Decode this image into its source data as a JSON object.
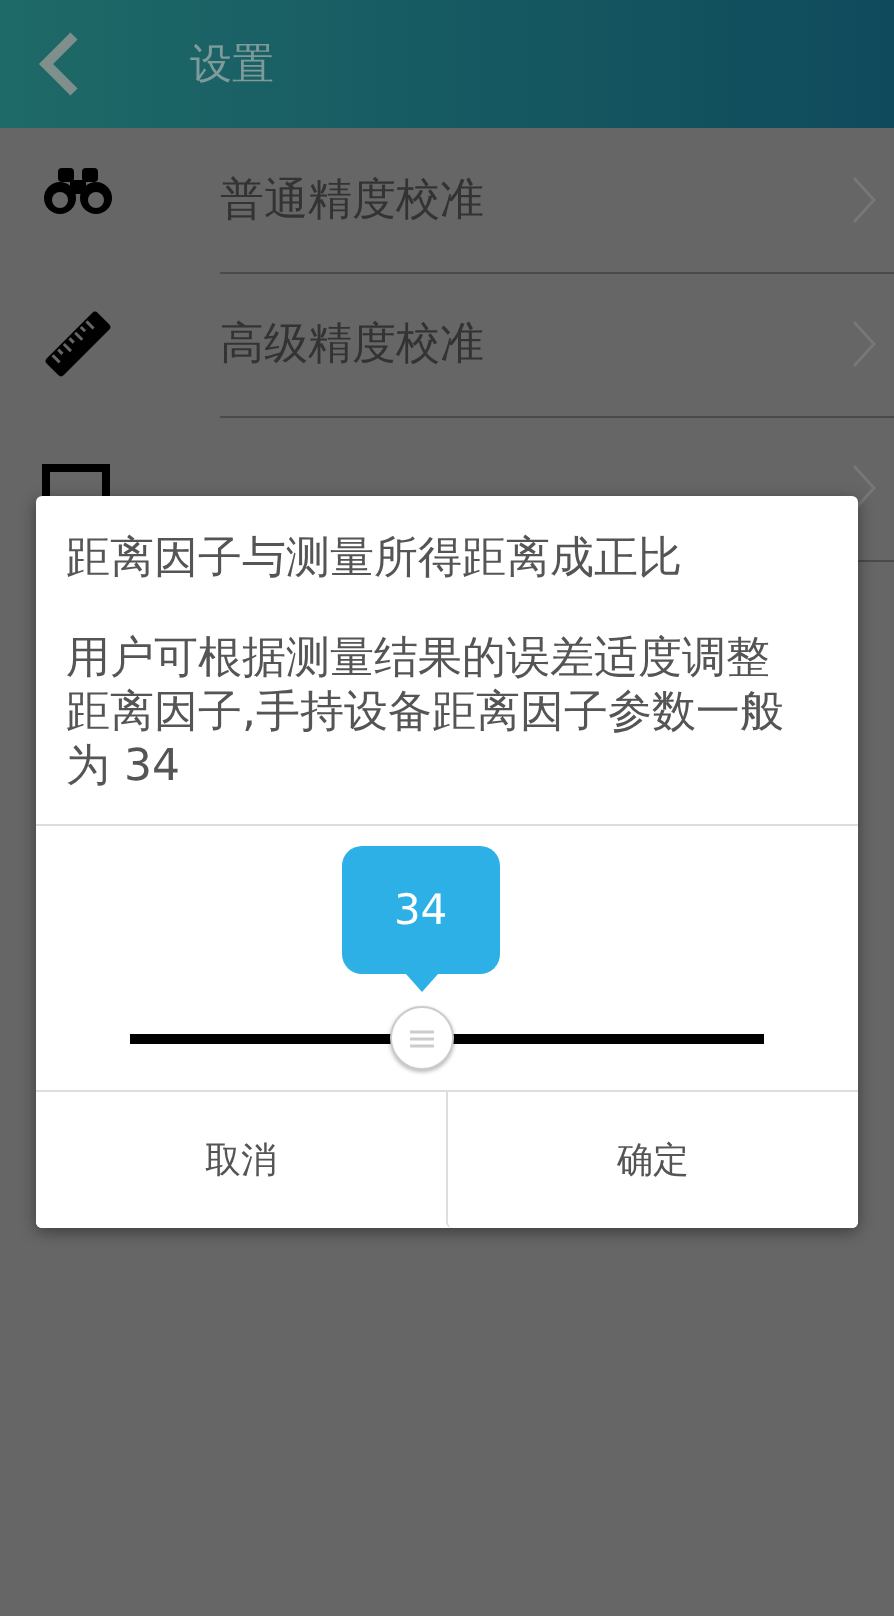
{
  "header": {
    "title": "设置"
  },
  "settings": [
    {
      "kind": "binoculars",
      "label": "普通精度校准"
    },
    {
      "kind": "ruler",
      "label": "高级精度校准"
    },
    {
      "kind": "frame"
    }
  ],
  "dialog": {
    "paragraphs": [
      "距离因子与测量所得距离成正比",
      "用户可根据测量结果的误差适度调整距离因子,手持设备距离因子参数一般为 34"
    ],
    "slider": {
      "value": "34",
      "level": 0.46
    },
    "buttons": [
      "取消",
      "确定"
    ]
  }
}
